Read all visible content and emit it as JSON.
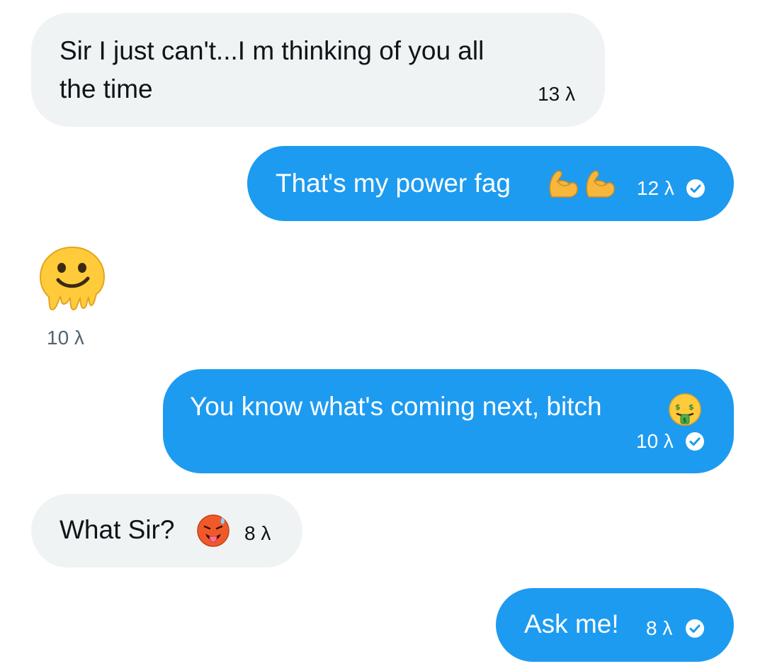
{
  "messages": [
    {
      "direction": "incoming",
      "text_line1": "Sir I just can't...I m thinking of you all",
      "text_line2": "the time",
      "time": "13 λ"
    },
    {
      "direction": "outgoing",
      "text": "That's my power fag",
      "emojis": [
        "flexed-biceps",
        "flexed-biceps"
      ],
      "time": "12 λ",
      "status": "read"
    },
    {
      "direction": "incoming",
      "emoji_only": "melting-face",
      "time": "10 λ"
    },
    {
      "direction": "outgoing",
      "text": "You know what's coming next, bitch",
      "emojis": [
        "money-mouth-face"
      ],
      "time": "10 λ",
      "status": "read"
    },
    {
      "direction": "incoming",
      "text": "What Sir?",
      "emojis": [
        "hot-face"
      ],
      "time": "8 λ"
    },
    {
      "direction": "outgoing",
      "text": "Ask me!",
      "time": "8 λ",
      "status": "read"
    }
  ],
  "colors": {
    "incoming_bubble": "#eff3f4",
    "outgoing_bubble": "#1d9bf0",
    "incoming_text": "#0f1419",
    "outgoing_text": "#ffffff",
    "timestamp_muted": "#536471"
  }
}
